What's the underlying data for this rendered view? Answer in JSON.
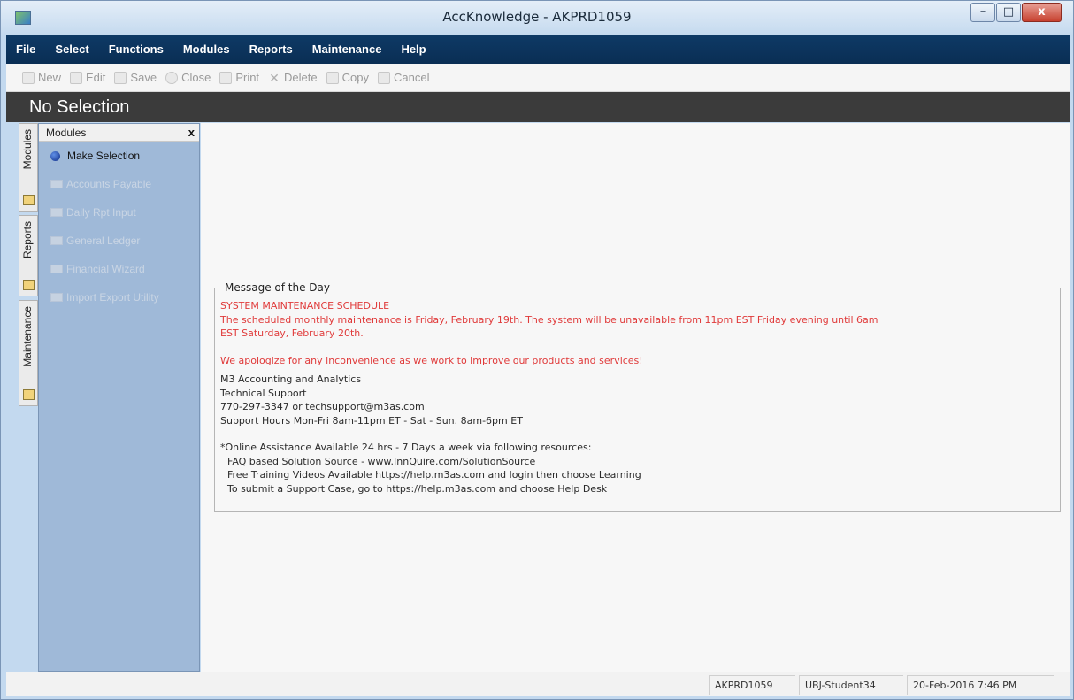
{
  "window": {
    "title": "AccKnowledge - AKPRD1059",
    "minimize": "–",
    "maximize": "□",
    "close": "x"
  },
  "menu": [
    "File",
    "Select",
    "Functions",
    "Modules",
    "Reports",
    "Maintenance",
    "Help"
  ],
  "toolbar": {
    "new": "New",
    "edit": "Edit",
    "save": "Save",
    "close": "Close",
    "print": "Print",
    "delete": "Delete",
    "copy": "Copy",
    "cancel": "Cancel"
  },
  "header": {
    "title": "No Selection"
  },
  "vtabs": [
    "Modules",
    "Reports",
    "Maintenance"
  ],
  "modules": {
    "title": "Modules",
    "close": "x",
    "items": [
      {
        "label": "Make Selection"
      },
      {
        "label": "Accounts Payable"
      },
      {
        "label": "Daily Rpt Input"
      },
      {
        "label": "General Ledger"
      },
      {
        "label": "Financial Wizard"
      },
      {
        "label": "Import Export Utility"
      }
    ]
  },
  "motd": {
    "title": "Message of the Day",
    "red_lines": [
      "SYSTEM MAINTENANCE SCHEDULE",
      "The scheduled monthly maintenance is Friday, February 19th.  The system will be unavailable from 11pm EST Friday evening until 6am",
      "EST Saturday, February 20th.",
      "We apologize for any inconvenience as we work to improve our products and services!"
    ],
    "contact_lines": [
      "M3 Accounting and Analytics",
      "Technical Support",
      "770-297-3347 or techsupport@m3as.com",
      "Support Hours Mon-Fri 8am-11pm ET - Sat - Sun. 8am-6pm ET"
    ],
    "resource_lines": [
      "*Online Assistance Available 24 hrs - 7 Days a week via following resources:",
      "FAQ based Solution Source - www.InnQuire.com/SolutionSource",
      "Free Training Videos Available https://help.m3as.com and login then choose Learning",
      "To submit a Support Case, go to https://help.m3as.com and choose Help Desk"
    ]
  },
  "status": {
    "server": "AKPRD1059",
    "user": "UBJ-Student34",
    "datetime": "20-Feb-2016 7:46 PM"
  }
}
